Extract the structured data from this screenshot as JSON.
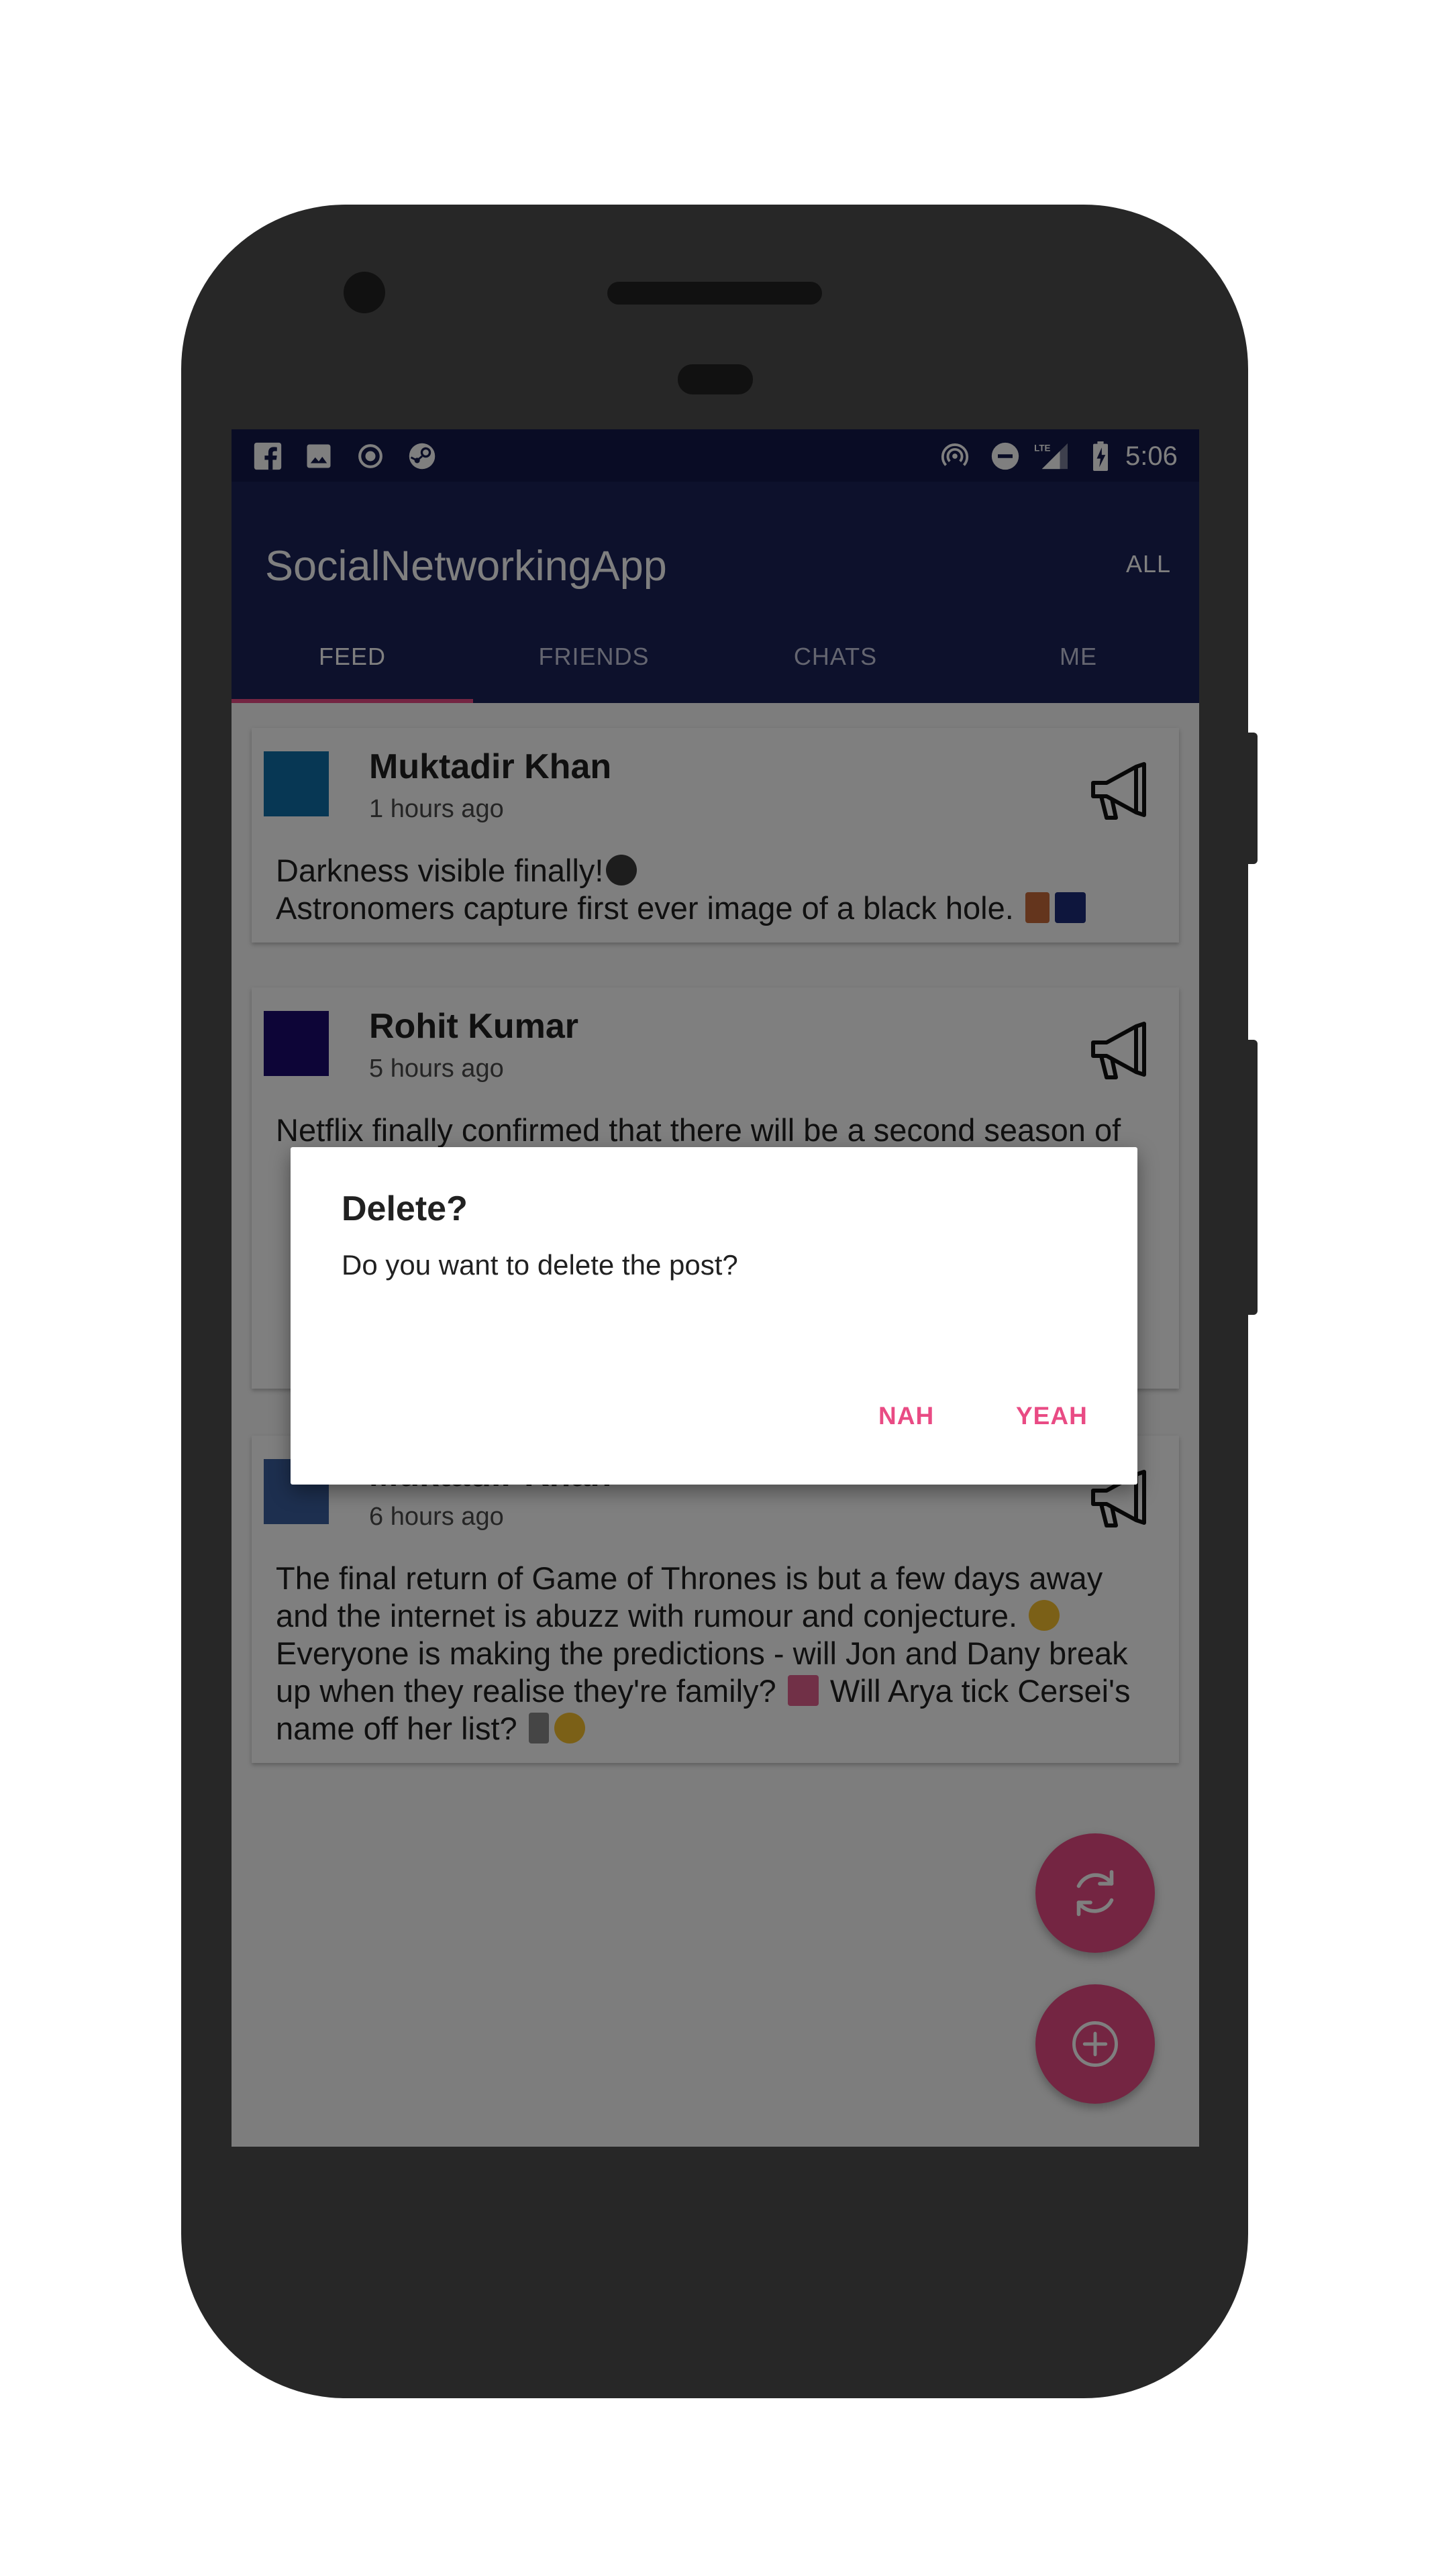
{
  "status_bar": {
    "time": "5:06",
    "network": "LTE",
    "left_icons": [
      "facebook-icon",
      "image-icon",
      "record-icon",
      "steam-icon"
    ],
    "right_icons": [
      "hotspot-icon",
      "do-not-disturb-icon",
      "signal-icon",
      "battery-charging-icon"
    ]
  },
  "app_bar": {
    "title": "SocialNetworkingApp",
    "action": "ALL"
  },
  "tabs": [
    {
      "label": "FEED",
      "active": true
    },
    {
      "label": "FRIENDS",
      "active": false
    },
    {
      "label": "CHATS",
      "active": false
    },
    {
      "label": "ME",
      "active": false
    }
  ],
  "posts": [
    {
      "author": "Muktadir Khan",
      "time": "1 hours ago",
      "avatar_color": "#0f6fa8",
      "lines": [
        "Darkness visible finally!",
        "Astronomers capture first ever image of a black hole."
      ]
    },
    {
      "author": "Rohit Kumar",
      "time": "5 hours ago",
      "avatar_color": "#1a0a6e",
      "lines": [
        "Netflix finally confirmed that there will be a second season of"
      ]
    },
    {
      "author": "Muktadir Khan",
      "time": "6 hours ago",
      "avatar_color": "#3a5f9e",
      "lines": [
        "The final return of Game of Thrones is but a few days away",
        "and the internet is abuzz with rumour and conjecture.",
        "Everyone is making the predictions - will Jon and Dany break",
        "up when they realise they're family?",
        "Will Arya tick Cersei's",
        "name off her list?"
      ]
    }
  ],
  "fabs": {
    "refresh_icon": "refresh-icon",
    "add_icon": "add-circle-icon"
  },
  "dialog": {
    "title": "Delete?",
    "message": "Do you want to delete the post?",
    "negative": "NAH",
    "positive": "YEAH"
  },
  "colors": {
    "primary": "#1b2259",
    "primary_dark": "#13194a",
    "accent": "#e94b84"
  }
}
